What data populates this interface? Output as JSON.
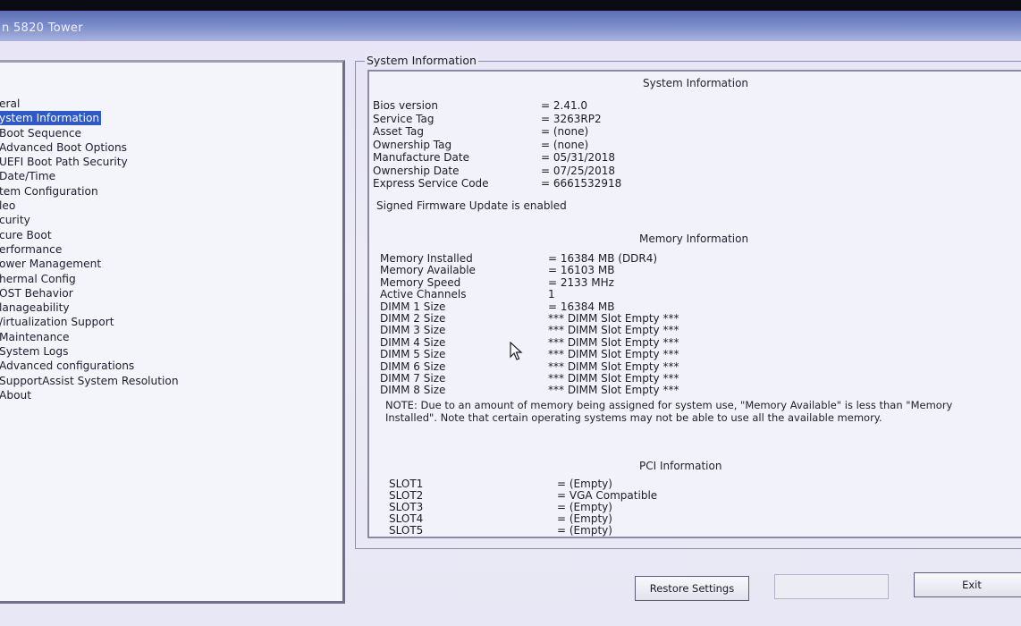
{
  "window": {
    "title": "n 5820 Tower"
  },
  "nav": {
    "items": [
      {
        "label": "eral"
      },
      {
        "label": "ystem Information",
        "selected": true
      },
      {
        "label": "Boot Sequence"
      },
      {
        "label": "Advanced Boot Options"
      },
      {
        "label": "UEFI Boot Path Security"
      },
      {
        "label": "Date/Time"
      },
      {
        "label": "tem Configuration"
      },
      {
        "label": "leo"
      },
      {
        "label": "curity"
      },
      {
        "label": "cure Boot"
      },
      {
        "label": "erformance"
      },
      {
        "label": "ower Management"
      },
      {
        "label": "hermal Config"
      },
      {
        "label": "OST Behavior"
      },
      {
        "label": "lanageability"
      },
      {
        "label": "/irtualization Support"
      },
      {
        "label": "Maintenance"
      },
      {
        "label": "System Logs"
      },
      {
        "label": "Advanced configurations"
      },
      {
        "label": "SupportAssist System Resolution"
      },
      {
        "label": "About"
      }
    ]
  },
  "main": {
    "frame_title": "System Information",
    "system": {
      "title": "System Information",
      "rows": [
        {
          "key": "Bios version",
          "value": "= 2.41.0"
        },
        {
          "key": "Service Tag",
          "value": "= 3263RP2"
        },
        {
          "key": "Asset Tag",
          "value": "= (none)"
        },
        {
          "key": "Ownership Tag",
          "value": "= (none)"
        },
        {
          "key": "Manufacture Date",
          "value": "= 05/31/2018"
        },
        {
          "key": "Ownership Date",
          "value": "= 07/25/2018"
        },
        {
          "key": "Express Service Code",
          "value": "= 6661532918"
        }
      ],
      "firmware_note": "Signed Firmware Update is enabled"
    },
    "memory": {
      "title": "Memory Information",
      "rows": [
        {
          "key": "Memory Installed",
          "value": "= 16384 MB (DDR4)"
        },
        {
          "key": "Memory Available",
          "value": "= 16103 MB"
        },
        {
          "key": "Memory Speed",
          "value": "= 2133 MHz"
        },
        {
          "key": "Active Channels",
          "value": "1"
        },
        {
          "key": "DIMM 1 Size",
          "value": "= 16384 MB"
        },
        {
          "key": "DIMM 2 Size",
          "value": "*** DIMM Slot Empty ***"
        },
        {
          "key": "DIMM 3 Size",
          "value": "*** DIMM Slot Empty ***"
        },
        {
          "key": "DIMM 4 Size",
          "value": "*** DIMM Slot Empty ***"
        },
        {
          "key": "DIMM 5 Size",
          "value": "*** DIMM Slot Empty ***"
        },
        {
          "key": "DIMM 6 Size",
          "value": "*** DIMM Slot Empty ***"
        },
        {
          "key": "DIMM 7 Size",
          "value": "*** DIMM Slot Empty ***"
        },
        {
          "key": "DIMM 8 Size",
          "value": "*** DIMM Slot Empty ***"
        }
      ],
      "note": "NOTE: Due to an amount of memory being assigned for system use, \"Memory Available\" is less than \"Memory Installed\". Note that certain operating systems may not be able to use all the available memory."
    },
    "pci": {
      "title": "PCI Information",
      "rows": [
        {
          "key": "SLOT1",
          "value": "= (Empty)"
        },
        {
          "key": "SLOT2",
          "value": "= VGA Compatible"
        },
        {
          "key": "SLOT3",
          "value": "= (Empty)"
        },
        {
          "key": "SLOT4",
          "value": "= (Empty)"
        },
        {
          "key": "SLOT5",
          "value": "= (Empty)"
        }
      ]
    }
  },
  "buttons": {
    "restore": "Restore Settings",
    "apply": "",
    "exit": "Exit"
  },
  "colors": {
    "selection": "#2f58c8",
    "titlebar": "#6a7cc0"
  },
  "icons": {
    "cursor": "arrow-pointer-icon"
  }
}
